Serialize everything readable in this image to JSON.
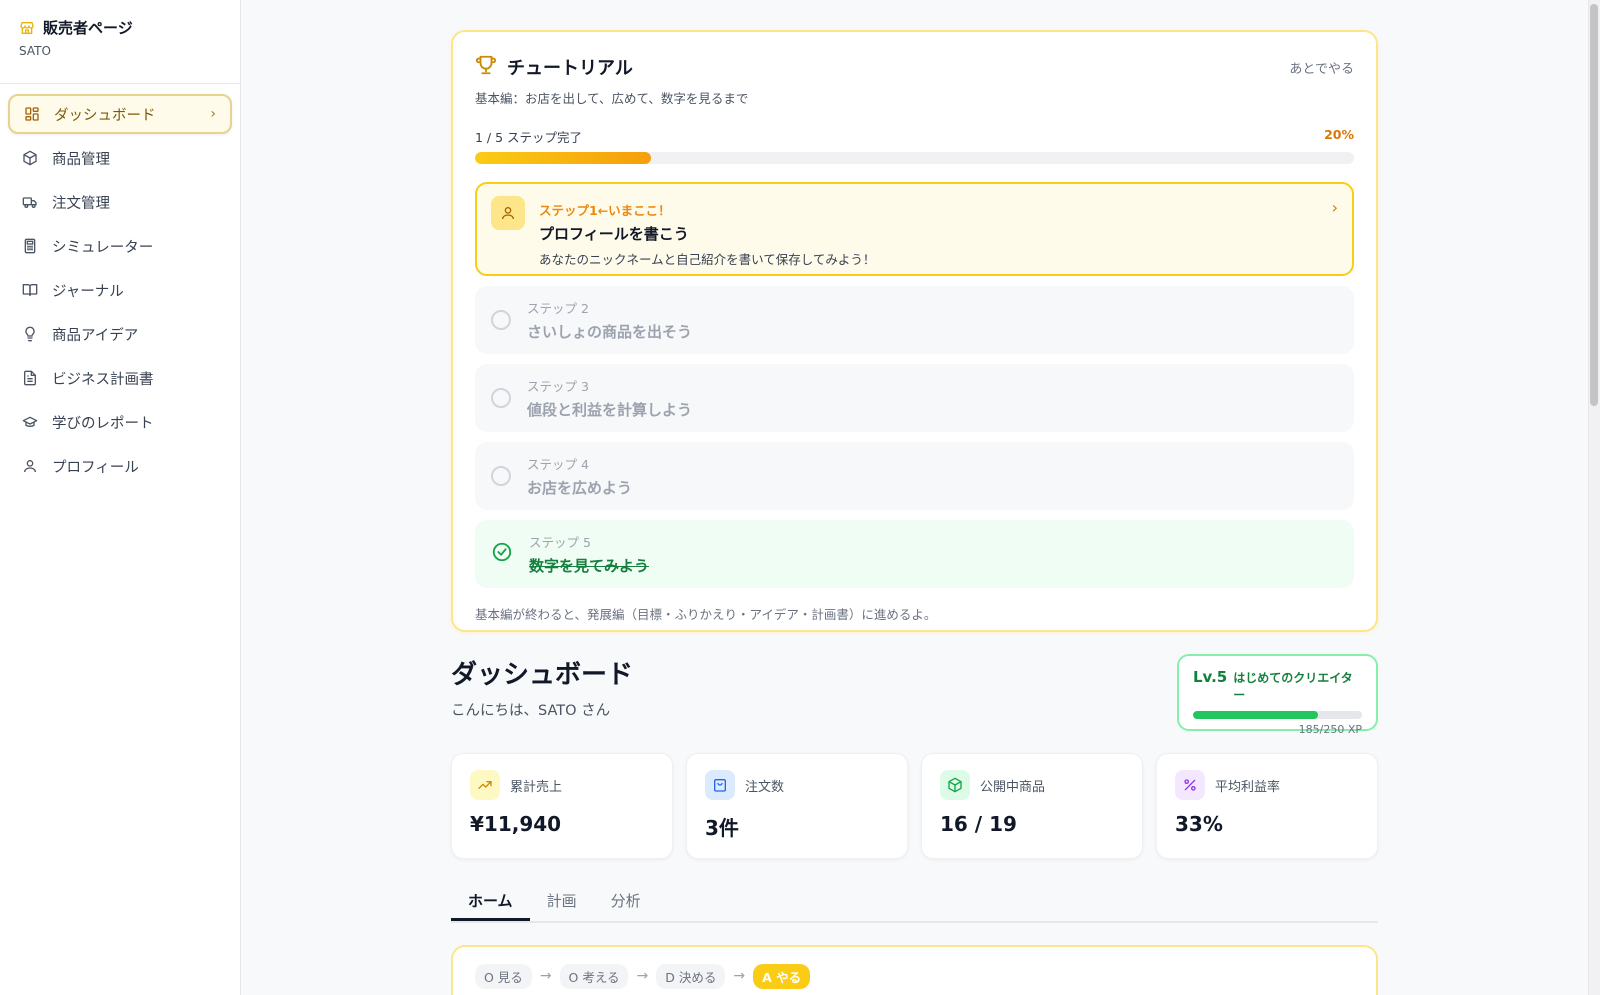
{
  "sidebar": {
    "brand_title": "販売者ページ",
    "brand_sub": "SATO",
    "items": [
      {
        "label": "ダッシュボード",
        "icon": "grid-icon"
      },
      {
        "label": "商品管理",
        "icon": "box-icon"
      },
      {
        "label": "注文管理",
        "icon": "truck-icon"
      },
      {
        "label": "シミュレーター",
        "icon": "calculator-icon"
      },
      {
        "label": "ジャーナル",
        "icon": "book-icon"
      },
      {
        "label": "商品アイデア",
        "icon": "lightbulb-icon"
      },
      {
        "label": "ビジネス計画書",
        "icon": "document-icon"
      },
      {
        "label": "学びのレポート",
        "icon": "graduation-cap-icon"
      },
      {
        "label": "プロフィール",
        "icon": "user-icon"
      }
    ]
  },
  "tutorial": {
    "title": "チュートリアル",
    "later": "あとでやる",
    "subtitle": "基本編：お店を出して、広めて、数字を見るまで",
    "progress_text": "1 / 5 ステップ完了",
    "progress_pct": "20%",
    "progress_value": 0.2,
    "current": {
      "label": "ステップ1←いまここ！",
      "title": "プロフィールを書こう",
      "desc": "あなたのニックネームと自己紹介を書いて保存してみよう！"
    },
    "steps": [
      {
        "label": "ステップ 2",
        "title": "さいしょの商品を出そう"
      },
      {
        "label": "ステップ 3",
        "title": "値段と利益を計算しよう"
      },
      {
        "label": "ステップ 4",
        "title": "お店を広めよう"
      }
    ],
    "done_step": {
      "label": "ステップ 5",
      "title": "数字を見てみよう"
    },
    "footer": "基本編が終わると、発展編（目標・ふりかえり・アイデア・計画書）に進めるよ。"
  },
  "dashboard": {
    "title": "ダッシュボード",
    "greeting": "こんにちは、SATO さん",
    "level": {
      "lv": "Lv.5",
      "name": "はじめてのクリエイター",
      "xp": "185/250 XP",
      "xp_value": 0.74
    }
  },
  "stats": [
    {
      "label": "累計売上",
      "value": "¥11,940",
      "icon": "trending-up-icon",
      "bg": "#fef9c3",
      "fg": "#ca8a04"
    },
    {
      "label": "注文数",
      "value": "3件",
      "icon": "shopping-bag-icon",
      "bg": "#dbeafe",
      "fg": "#2563eb"
    },
    {
      "label": "公開中商品",
      "value": "16 / 19",
      "icon": "package-icon",
      "bg": "#dcfce7",
      "fg": "#16a34a"
    },
    {
      "label": "平均利益率",
      "value": "33%",
      "icon": "percent-icon",
      "bg": "#f3e8ff",
      "fg": "#9333ea"
    }
  ],
  "tabs": [
    {
      "label": "ホーム"
    },
    {
      "label": "計画"
    },
    {
      "label": "分析"
    }
  ],
  "ooda": [
    {
      "label": "O 見る"
    },
    {
      "label": "O 考える"
    },
    {
      "label": "D 決める"
    },
    {
      "label": "A やる"
    }
  ],
  "colors": {
    "accent": "#facc15",
    "accent_dark": "#d97706",
    "success": "#22c55e"
  }
}
